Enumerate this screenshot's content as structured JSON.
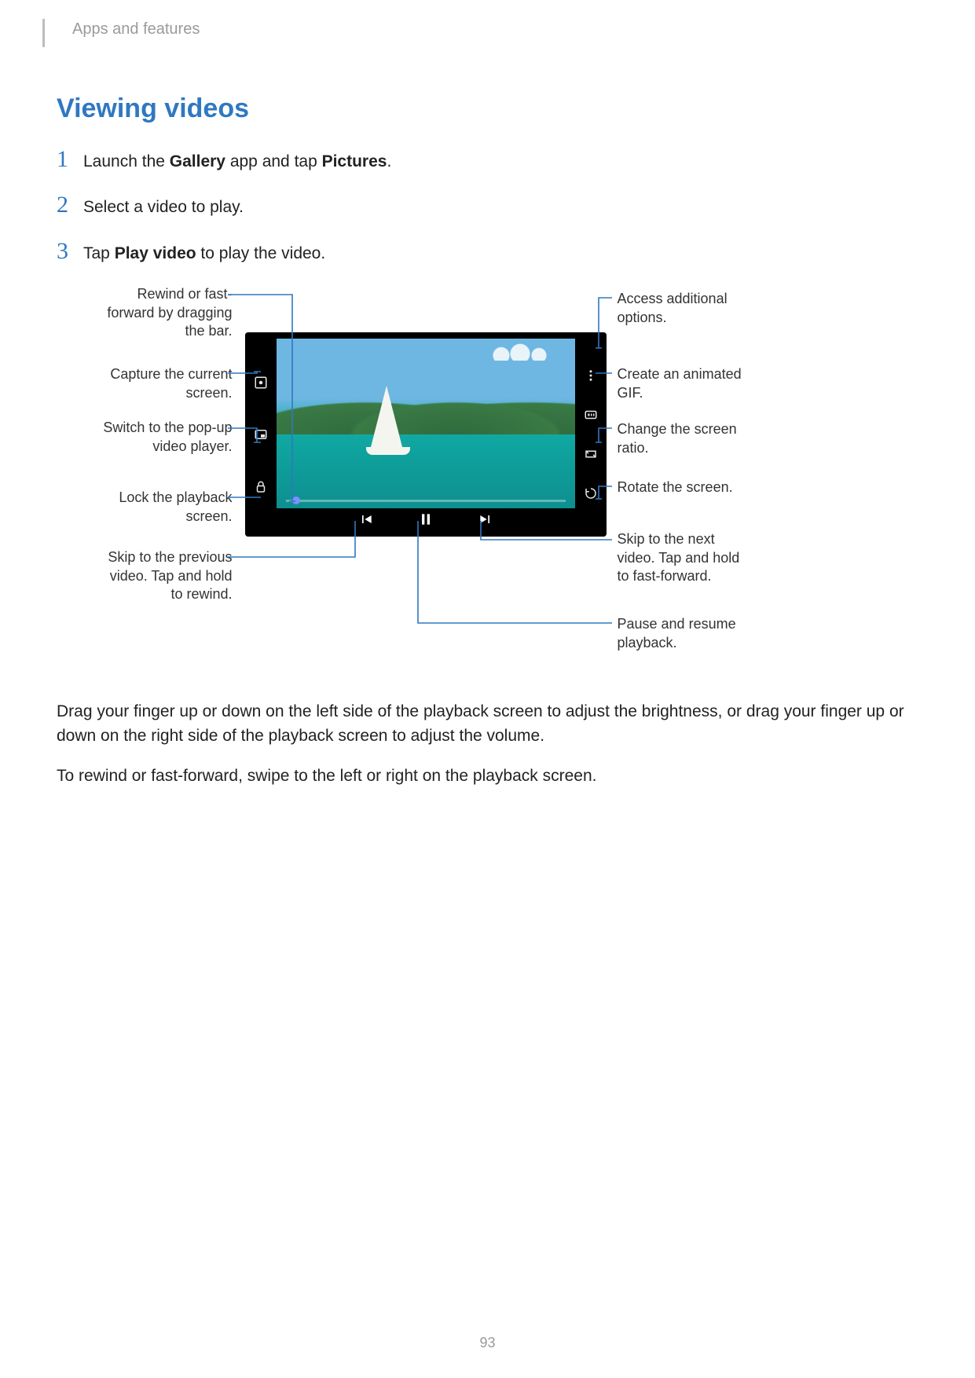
{
  "header": "Apps and features",
  "title": "Viewing videos",
  "steps": [
    {
      "num": "1",
      "pre": "Launch the ",
      "b1": "Gallery",
      "mid": " app and tap ",
      "b2": "Pictures",
      "post": "."
    },
    {
      "num": "2",
      "pre": "Select a video to play.",
      "b1": "",
      "mid": "",
      "b2": "",
      "post": ""
    },
    {
      "num": "3",
      "pre": "Tap ",
      "b1": "Play video",
      "mid": " to play the video.",
      "b2": "",
      "post": ""
    }
  ],
  "callouts_left": {
    "rewind": "Rewind or fast-forward by dragging the bar.",
    "capture": "Capture the current screen.",
    "popup": "Switch to the pop-up video player.",
    "lock": "Lock the playback screen.",
    "prev": "Skip to the previous video. Tap and hold to rewind."
  },
  "callouts_right": {
    "options": "Access additional options.",
    "gif": "Create an animated GIF.",
    "ratio": "Change the screen ratio.",
    "rotate": "Rotate the screen.",
    "next": "Skip to the next video. Tap and hold to fast-forward.",
    "pause": "Pause and resume playback."
  },
  "para1": "Drag your finger up or down on the left side of the playback screen to adjust the brightness, or drag your finger up or down on the right side of the playback screen to adjust the volume.",
  "para2": "To rewind or fast-forward, swipe to the left or right on the playback screen.",
  "page_number": "93"
}
